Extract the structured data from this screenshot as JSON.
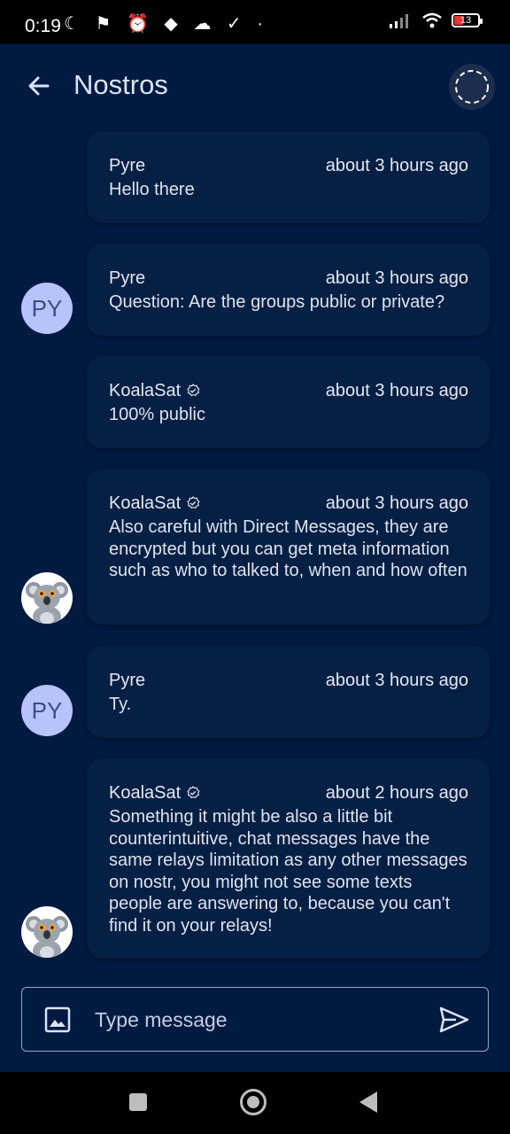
{
  "status_bar": {
    "time": "0:19",
    "indicators": "☾ ⚑ ⏰ ◆ ☁ ✓ ·",
    "battery": "13"
  },
  "header": {
    "title": "Nostros"
  },
  "messages": [
    {
      "author": "Pyre",
      "time": "about 3 hours ago",
      "text": "Hello there",
      "verified": false
    },
    {
      "author": "Pyre",
      "time": "about 3 hours ago",
      "text": "Question: Are the groups public or private?",
      "verified": false
    },
    {
      "author": "KoalaSat",
      "time": "about 3 hours ago",
      "text": "100% public",
      "verified": true
    },
    {
      "author": "KoalaSat",
      "time": "about 3 hours ago",
      "text": "Also careful with Direct Messages, they are encrypted but you can get meta information such as who to talked to, when and how often",
      "verified": true
    },
    {
      "author": "Pyre",
      "time": "about 3 hours ago",
      "text": "Ty.",
      "verified": false
    },
    {
      "author": "KoalaSat",
      "time": "about 2 hours ago",
      "text": "Something it might be also a little bit counterintuitive, chat messages have the same relays limitation as any other messages on nostr, you might not see some texts people are answering to, because you can't find it on your relays!",
      "verified": true
    }
  ],
  "avatars": {
    "pyre_initials": "PY"
  },
  "composer": {
    "placeholder": "Type message"
  },
  "colors": {
    "background": "#001a42",
    "bubble": "#061f44",
    "avatar_py_bg": "#b9c3fb"
  }
}
